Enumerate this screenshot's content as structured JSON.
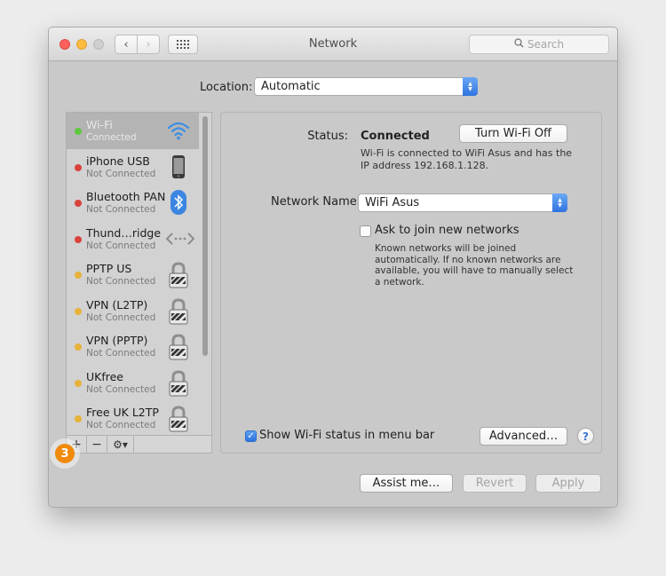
{
  "window": {
    "title": "Network"
  },
  "search": {
    "placeholder": "Search"
  },
  "location": {
    "label": "Location:",
    "value": "Automatic"
  },
  "services": [
    {
      "name": "Wi-Fi",
      "state": "Connected",
      "status_color": "#5fc83f",
      "icon": "wifi-icon",
      "selected": true
    },
    {
      "name": "iPhone USB",
      "state": "Not Connected",
      "status_color": "#d9423b",
      "icon": "iphone-icon"
    },
    {
      "name": "Bluetooth PAN",
      "state": "Not Connected",
      "status_color": "#d9423b",
      "icon": "bluetooth-icon"
    },
    {
      "name": "Thund…ridge",
      "state": "Not Connected",
      "status_color": "#d9423b",
      "icon": "thunderbolt-bridge-icon"
    },
    {
      "name": "PPTP US",
      "state": "Not Connected",
      "status_color": "#e6b23a",
      "icon": "vpn-lock-icon"
    },
    {
      "name": "VPN (L2TP)",
      "state": "Not Connected",
      "status_color": "#e6b23a",
      "icon": "vpn-lock-icon"
    },
    {
      "name": "VPN (PPTP)",
      "state": "Not Connected",
      "status_color": "#e6b23a",
      "icon": "vpn-lock-icon"
    },
    {
      "name": "UKfree",
      "state": "Not Connected",
      "status_color": "#e6b23a",
      "icon": "vpn-lock-icon"
    },
    {
      "name": "Free UK L2TP",
      "state": "Not Connected",
      "status_color": "#e6b23a",
      "icon": "vpn-lock-icon"
    }
  ],
  "toolbar": {
    "add": "+",
    "remove": "−",
    "gear": "⚙▾"
  },
  "badge": {
    "number": "3"
  },
  "panel": {
    "status_label": "Status:",
    "status_value": "Connected",
    "turn_off_label": "Turn Wi-Fi Off",
    "status_description": "Wi-Fi is connected to WiFi Asus and has the IP address 192.168.1.128.",
    "network_name_label": "Network Name:",
    "network_name_value": "WiFi Asus",
    "ask_label": "Ask to join new networks",
    "ask_description": "Known networks will be joined automatically. If no known networks are available, you will have to manually select a network.",
    "show_status_label": "Show Wi-Fi status in menu bar",
    "advanced_label": "Advanced…",
    "help_label": "?"
  },
  "footer": {
    "assist_label": "Assist me…",
    "revert_label": "Revert",
    "apply_label": "Apply"
  }
}
